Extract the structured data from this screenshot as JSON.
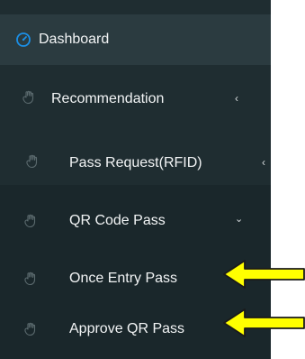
{
  "sidebar": {
    "items": [
      {
        "label": "Dashboard",
        "icon": "dashboard-gauge-icon"
      },
      {
        "label": "Recommendation",
        "icon": "hand-icon",
        "chevron": "‹"
      },
      {
        "label": "Pass Request(RFID)",
        "icon": "hand-icon",
        "chevron": "‹"
      },
      {
        "label": "QR Code Pass",
        "icon": "hand-icon",
        "chevron": "⌄"
      },
      {
        "label": "Once Entry Pass",
        "icon": "hand-icon"
      },
      {
        "label": "Approve QR Pass",
        "icon": "hand-icon"
      }
    ]
  },
  "colors": {
    "sidebar_bg": "#1f2d31",
    "submenu_bg": "#1a272b",
    "active_bg": "#2b3b40",
    "accent": "#1b8fe6",
    "arrow": "#ffff00"
  }
}
